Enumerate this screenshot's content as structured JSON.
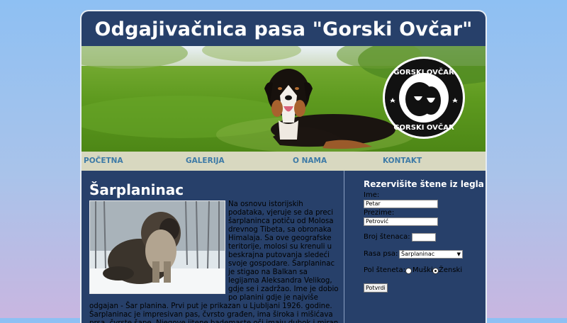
{
  "header": {
    "title": "Odgajivačnica pasa \"Gorski Ovčar\""
  },
  "logo": {
    "text_top": "GORSKI OVČAR",
    "text_bottom": "GORSKI OVČAR"
  },
  "nav": {
    "items": [
      {
        "label": "POČETNA"
      },
      {
        "label": "GALERIJA"
      },
      {
        "label": "O NAMA"
      },
      {
        "label": "KONTAKT"
      }
    ]
  },
  "article": {
    "title": "Šarplaninac",
    "text": "Na osnovu istorijskih podataka, vjeruje se da preci šarplaninca potiču od Molosa drevnog Tibeta, sa obronaka Himalaja. Sa ove geografske teritorije, molosi su krenuli u beskrajna putovanja sledeći svoje gospodare. Šarplaninac je stigao na Balkan sa legijama Aleksandra Velikog, gdje se i zadržao. Ime je dobio po planini gdje je najviše odgajan - Šar planina. Prvi put je prikazan u Ljubljani 1926. godine. Šarplaninac je impresivan pas, čvrsto građen, ima široka i mišićava prsa, čvrste šape. Njegove jitene bademaste oči imaju dubok i miran pogled, pomalo"
  },
  "form": {
    "title": "Rezervišite štene iz legla",
    "first_name_label": "Ime:",
    "first_name_value": "Petar",
    "last_name_label": "Prezime:",
    "last_name_value": "Petrović",
    "count_label": "Broj štenaca:",
    "count_value": "",
    "breed_label": "Rasa psa:",
    "breed_value": "Šarplaninac",
    "sex_label": "Pol šteneta:",
    "sex_male": "Muški",
    "sex_female": "Ženski",
    "sex_selected": "Ženski",
    "submit_label": "Potvrdi"
  },
  "colors": {
    "page_bg": "#27406a",
    "nav_bg": "#d8d8c0",
    "nav_text": "#3d7aa6"
  }
}
